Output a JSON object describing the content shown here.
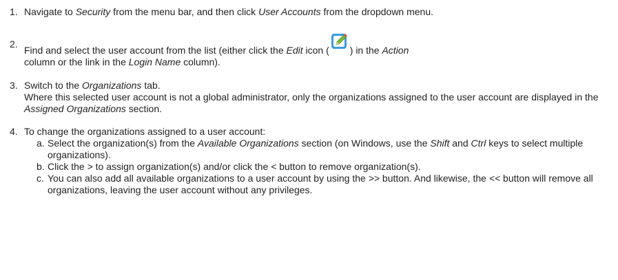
{
  "steps": [
    {
      "num": "1.",
      "parts": [
        "Navigate to ",
        "Security",
        " from the menu bar, and then click ",
        "User Accounts",
        " from the dropdown menu."
      ]
    },
    {
      "num": "2.",
      "parts": [
        "Find and select the user account from the list (either click the ",
        "Edit",
        " icon (",
        ") in the ",
        "Action",
        " column or the link in the ",
        "Login Name",
        " column)."
      ]
    },
    {
      "num": "3.",
      "parts": [
        "Switch to the ",
        "Organizations",
        " tab."
      ],
      "line2": "Where this selected user account is not a global administrator, only the organizations assigned to the user account are displayed in the ",
      "line2_em": "Assigned Organizations",
      "line2_end": " section."
    },
    {
      "num": "4.",
      "intro": "To change the organizations assigned to a user account:",
      "subs": [
        {
          "letter": "a.",
          "parts": [
            "Select the organization(s) from the ",
            "Available Organizations",
            " section (on Windows, use the ",
            "Shift",
            " and ",
            "Ctrl",
            " keys to select multiple organizations)."
          ]
        },
        {
          "letter": "b.",
          "parts": [
            "Click the ",
            ">",
            " to assign organization(s) and/or click the ",
            "<",
            " button to remove organization(s)."
          ]
        },
        {
          "letter": "c.",
          "parts": [
            "You can also add all available organizations to a user account by using the ",
            ">>",
            " button. And likewise, the ",
            "<<",
            " button will remove all organizations, leaving the user account without any privileges."
          ]
        }
      ]
    }
  ],
  "icon": {
    "name": "edit-icon",
    "bg": "#3a9be0",
    "pen": "#7dbb3a"
  }
}
